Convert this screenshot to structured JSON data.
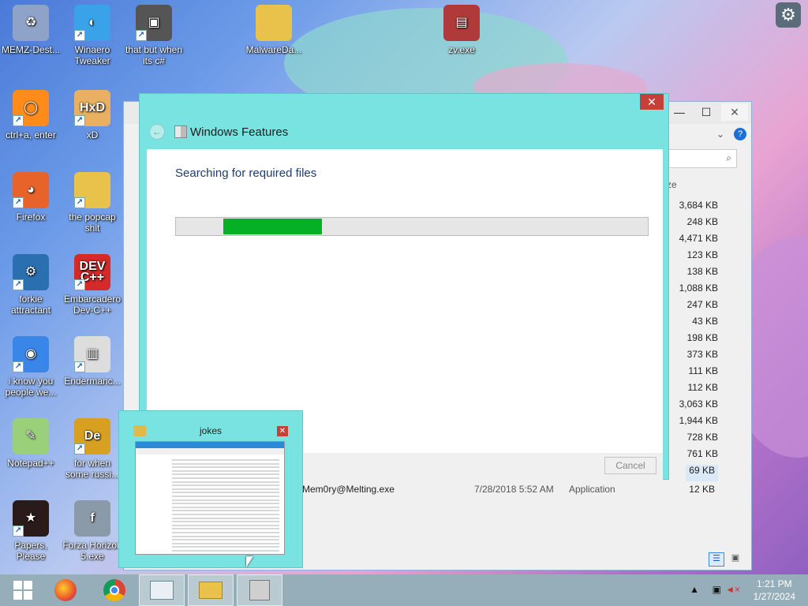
{
  "desktop_icons": [
    {
      "label": "MEMZ-Dest...",
      "icon": "recycle-bin-icon",
      "color": "#8fa3c8",
      "glyph": "♻",
      "shortcut": false
    },
    {
      "label": "Winaero Tweaker",
      "icon": "winaero-icon",
      "color": "#3aa2e8",
      "glyph": "◐",
      "shortcut": true
    },
    {
      "label": "that but when its c#",
      "icon": "windows-stack-icon",
      "color": "#555555",
      "glyph": "▣",
      "shortcut": true
    },
    {
      "label": "MalwareDa...",
      "icon": "folder-icon",
      "color": "#e8c24a",
      "glyph": "",
      "shortcut": false
    },
    {
      "label": "zv.exe",
      "icon": "winrar-icon",
      "color": "#b03a3a",
      "glyph": "▤",
      "shortcut": false
    },
    {
      "label": "ctrl+a, enter",
      "icon": "magnifier-icon",
      "color": "#ff8c1a",
      "glyph": "◯",
      "shortcut": true
    },
    {
      "label": "xD",
      "icon": "hxd-icon",
      "color": "#e8b060",
      "glyph": "HxD",
      "shortcut": true
    },
    {
      "label": "Firefox",
      "icon": "firefox-icon",
      "color": "#e8632a",
      "glyph": "◕",
      "shortcut": true
    },
    {
      "label": "the popcap shit",
      "icon": "popcap-folder-icon",
      "color": "#e8c24a",
      "glyph": "",
      "shortcut": true
    },
    {
      "label": "forkie attractant",
      "icon": "monitor-gear-icon",
      "color": "#2a6fb0",
      "glyph": "⚙",
      "shortcut": true
    },
    {
      "label": "Embarcadero Dev-C++",
      "icon": "devcpp-icon",
      "color": "#d42a2a",
      "glyph": "DEV C++",
      "shortcut": true
    },
    {
      "label": "i know you people we...",
      "icon": "chrome-icon",
      "color": "#3a86e8",
      "glyph": "◉",
      "shortcut": true
    },
    {
      "label": "Endermanc...",
      "icon": "window-app-icon",
      "color": "#dddddd",
      "glyph": "▥",
      "shortcut": true
    },
    {
      "label": "Notepad++",
      "icon": "notepadpp-icon",
      "color": "#9ad07a",
      "glyph": "✎",
      "shortcut": false
    },
    {
      "label": "for when some russi...",
      "icon": "de-app-icon",
      "color": "#d8a020",
      "glyph": "De",
      "shortcut": true
    },
    {
      "label": "Papers, Please",
      "icon": "papers-please-icon",
      "color": "#2a1a1a",
      "glyph": "★",
      "shortcut": true
    },
    {
      "label": "Forza Horizon 5.exe",
      "icon": "flash-icon",
      "color": "#8a9aa8",
      "glyph": "f",
      "shortcut": false
    }
  ],
  "explorer": {
    "size_header": "ze",
    "sizes": [
      "3,684 KB",
      "248 KB",
      "4,471 KB",
      "123 KB",
      "138 KB",
      "1,088 KB",
      "247 KB",
      "43 KB",
      "198 KB",
      "373 KB",
      "111 KB",
      "112 KB",
      "3,063 KB",
      "1,944 KB",
      "728 KB",
      "761 KB",
      "69 KB"
    ],
    "last_row": {
      "name": "Mem0ry@Melting.exe",
      "date": "7/28/2018 5:52 AM",
      "type": "Application",
      "size": "12 KB"
    }
  },
  "features_dialog": {
    "title": "Windows Features",
    "heading": "Searching for required files",
    "progress_start": 0.1,
    "progress_end": 0.31,
    "cancel_label": "Cancel",
    "accent": "#79e3e1",
    "progress_color": "#06b025"
  },
  "thumbnail": {
    "title": "jokes"
  },
  "taskbar": {
    "time": "1:21 PM",
    "date": "1/27/2024",
    "apps": [
      "start-icon",
      "firefox-icon",
      "chrome-icon",
      "task-manager-icon",
      "file-explorer-icon",
      "installer-icon"
    ]
  }
}
